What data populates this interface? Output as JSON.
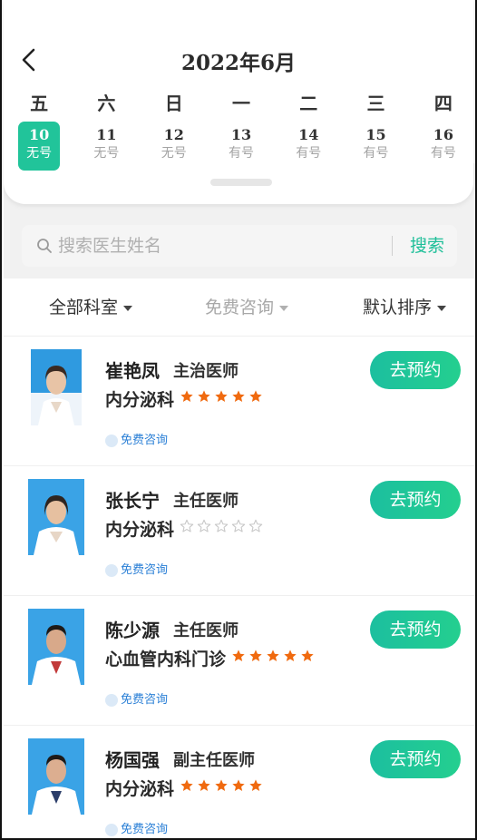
{
  "header": {
    "title": "2022年6月"
  },
  "calendar": [
    {
      "weekday": "五",
      "date": "10",
      "status": "无号",
      "selected": true
    },
    {
      "weekday": "六",
      "date": "11",
      "status": "无号",
      "selected": false
    },
    {
      "weekday": "日",
      "date": "12",
      "status": "无号",
      "selected": false
    },
    {
      "weekday": "一",
      "date": "13",
      "status": "有号",
      "selected": false
    },
    {
      "weekday": "二",
      "date": "14",
      "status": "有号",
      "selected": false
    },
    {
      "weekday": "三",
      "date": "15",
      "status": "有号",
      "selected": false
    },
    {
      "weekday": "四",
      "date": "16",
      "status": "有号",
      "selected": false
    }
  ],
  "search": {
    "placeholder": "搜索医生姓名",
    "button": "搜索"
  },
  "filters": {
    "department": "全部科室",
    "consult": "免费咨询",
    "sort": "默认排序"
  },
  "doctors": [
    {
      "name": "崔艳凤",
      "title": "主治医师",
      "department": "内分泌科",
      "rating": 5,
      "tag": "免费咨询",
      "button": "去预约"
    },
    {
      "name": "张长宁",
      "title": "主任医师",
      "department": "内分泌科",
      "rating": 0,
      "tag": "免费咨询",
      "button": "去预约"
    },
    {
      "name": "陈少源",
      "title": "主任医师",
      "department": "心血管内科门诊",
      "rating": 5,
      "tag": "免费咨询",
      "button": "去预约"
    },
    {
      "name": "杨国强",
      "title": "副主任医师",
      "department": "内分泌科",
      "rating": 5,
      "tag": "免费咨询",
      "button": "去预约"
    }
  ],
  "colors": {
    "accent": "#21c49a",
    "star": "#f06a0f",
    "star_empty": "#c8c8c8",
    "link": "#2a7fd6"
  }
}
